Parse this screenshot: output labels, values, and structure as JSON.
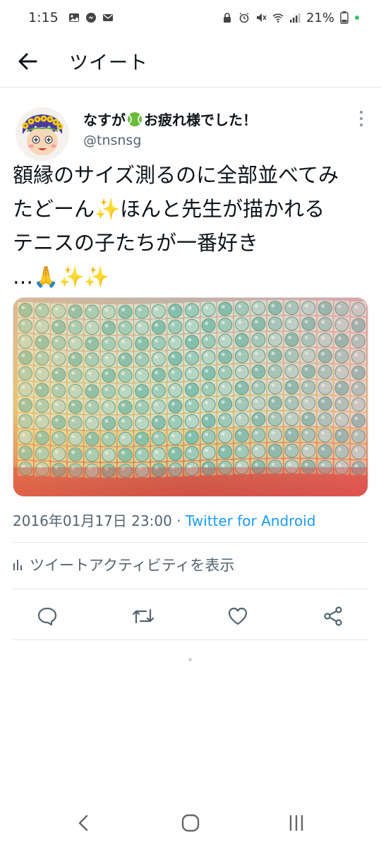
{
  "status_bar": {
    "time": "1:15",
    "battery": "21%"
  },
  "header": {
    "title": "ツイート"
  },
  "tweet": {
    "display_name": "なすが",
    "display_name_suffix": "お疲れ様でした！",
    "username": "@tnsnsg",
    "text_lines": [
      "額縁のサイズ測るのに全部並べてみ",
      "たどーん✨ほんと先生が描かれる",
      "テニスの子たちが一番好き",
      "…🙏✨✨"
    ],
    "timestamp": "2016年01月17日 23:00",
    "separator": " · ",
    "source": "Twitter for Android",
    "activity_label": "ツイートアクティビティを表示"
  },
  "icons": {
    "back": "arrow-left-icon",
    "more": "more-vertical-icon",
    "reply": "comment-icon",
    "retweet": "retweet-icon",
    "like": "heart-icon",
    "share": "share-icon",
    "activity": "bar-chart-icon"
  },
  "colors": {
    "link": "#1d9bf0",
    "secondary_text": "#536471",
    "primary_text": "#0f1419",
    "divider": "#e6e6e6"
  }
}
